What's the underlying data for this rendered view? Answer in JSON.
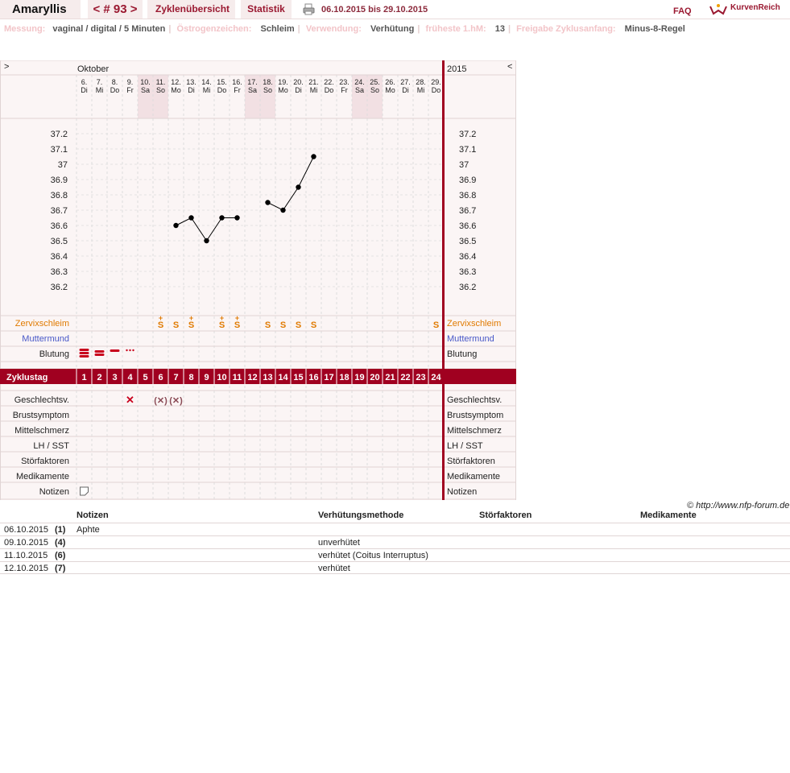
{
  "header": {
    "app_name": "Amaryllis",
    "cycle_nav": "< # 93 >",
    "tab_overview": "Zyklenübersicht",
    "tab_stats": "Statistik",
    "date_range": "06.10.2015 bis 29.10.2015",
    "faq": "FAQ",
    "logo_text": "KurvenReich"
  },
  "info": [
    {
      "key": "Messung:",
      "value": "vaginal / digital / 5 Minuten"
    },
    {
      "key": "Östrogenzeichen:",
      "value": "Schleim"
    },
    {
      "key": "Verwendung:",
      "value": "Verhütung"
    },
    {
      "key": "früheste 1.hM:",
      "value": "13"
    },
    {
      "key": "Freigabe Zyklusanfang:",
      "value": "Minus-8-Regel"
    }
  ],
  "chart_data": {
    "type": "line",
    "title": "",
    "month": "Oktober",
    "year": "2015",
    "nav_prev": ">",
    "nav_next": "<",
    "dates": [
      "6.",
      "7.",
      "8.",
      "9.",
      "10.",
      "11.",
      "12.",
      "13.",
      "14.",
      "15.",
      "16.",
      "17.",
      "18.",
      "19.",
      "20.",
      "21.",
      "22.",
      "23.",
      "24.",
      "25.",
      "26.",
      "27.",
      "28.",
      "29."
    ],
    "weekdays": [
      "Di",
      "Mi",
      "Do",
      "Fr",
      "Sa",
      "So",
      "Mo",
      "Di",
      "Mi",
      "Do",
      "Fr",
      "Sa",
      "So",
      "Mo",
      "Di",
      "Mi",
      "Do",
      "Fr",
      "Sa",
      "So",
      "Mo",
      "Di",
      "Mi",
      "Do"
    ],
    "weekend_index": [
      4,
      5,
      11,
      12,
      18,
      19
    ],
    "cycle_days": [
      1,
      2,
      3,
      4,
      5,
      6,
      7,
      8,
      9,
      10,
      11,
      12,
      13,
      14,
      15,
      16,
      17,
      18,
      19,
      20,
      21,
      22,
      23,
      24
    ],
    "y_ticks": [
      "37.2",
      "37.1",
      "37",
      "36.9",
      "36.8",
      "36.7",
      "36.6",
      "36.5",
      "36.4",
      "36.3",
      "36.2"
    ],
    "ylim": [
      36.2,
      37.2
    ],
    "series": [
      {
        "segments": [
          [
            [
              7,
              36.6
            ],
            [
              8,
              36.65
            ],
            [
              9,
              36.5
            ],
            [
              10,
              36.65
            ],
            [
              11,
              36.65
            ]
          ],
          [
            [
              13,
              36.75
            ],
            [
              14,
              36.7
            ],
            [
              15,
              36.85
            ],
            [
              16,
              37.05
            ]
          ]
        ]
      }
    ],
    "cervix_marks": [
      {
        "day": 6,
        "symbol": "S",
        "plus": true
      },
      {
        "day": 7,
        "symbol": "S",
        "plus": false
      },
      {
        "day": 8,
        "symbol": "S",
        "plus": true
      },
      {
        "day": 10,
        "symbol": "S",
        "plus": true
      },
      {
        "day": 11,
        "symbol": "S",
        "plus": true
      },
      {
        "day": 13,
        "symbol": "S",
        "plus": false
      },
      {
        "day": 14,
        "symbol": "S",
        "plus": false
      },
      {
        "day": 15,
        "symbol": "S",
        "plus": false
      },
      {
        "day": 16,
        "symbol": "S",
        "plus": false
      },
      {
        "day": 24,
        "symbol": "S",
        "plus": false
      }
    ],
    "bleeding": [
      {
        "day": 1,
        "level": "strong"
      },
      {
        "day": 2,
        "level": "medium"
      },
      {
        "day": 3,
        "level": "light"
      },
      {
        "day": 4,
        "level": "spotting"
      }
    ],
    "intercourse": [
      {
        "day": 4,
        "symbol": "✕"
      },
      {
        "day": 6,
        "symbol": "(✕)"
      },
      {
        "day": 7,
        "symbol": "(✕)"
      }
    ],
    "note_days": [
      1
    ],
    "row_labels": {
      "cervix": "Zervixschleim",
      "cervix_pos": "Muttermund",
      "bleeding": "Blutung",
      "cycle_day": "Zyklustag",
      "sex": "Geschlechtsv.",
      "breast": "Brustsymptom",
      "mittel": "Mittelschmerz",
      "lh": "LH / SST",
      "stoer": "Störfaktoren",
      "meds": "Medikamente",
      "notes": "Notizen"
    },
    "colors": {
      "accent": "#a00020",
      "cervix": "#e07a00",
      "cervix_pos": "#4858c8",
      "weekend": "#f2e0e3",
      "plot_bg": "#fbf5f5"
    }
  },
  "copyright": "© http://www.nfp-forum.de",
  "notes_table": {
    "headers": [
      "Notizen",
      "Verhütungsmethode",
      "Störfaktoren",
      "Medikamente"
    ],
    "rows": [
      {
        "date": "06.10.2015",
        "day": "(1)",
        "note": "Aphte",
        "method": ""
      },
      {
        "date": "09.10.2015",
        "day": "(4)",
        "note": "",
        "method": "unverhütet"
      },
      {
        "date": "11.10.2015",
        "day": "(6)",
        "note": "",
        "method": "verhütet (Coitus Interruptus)"
      },
      {
        "date": "12.10.2015",
        "day": "(7)",
        "note": "",
        "method": "verhütet"
      }
    ]
  }
}
